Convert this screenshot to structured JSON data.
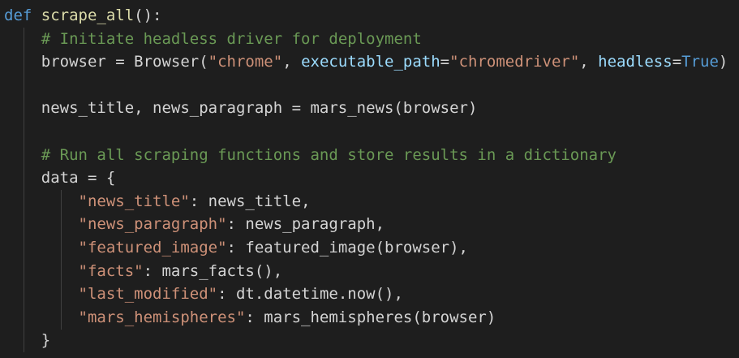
{
  "lines": [
    [
      {
        "t": "def",
        "c": "kw"
      },
      {
        "t": " ",
        "c": "plain"
      },
      {
        "t": "scrape_all",
        "c": "fn"
      },
      {
        "t": "():",
        "c": "plain"
      }
    ],
    [
      {
        "t": "    ",
        "c": "plain"
      },
      {
        "t": "# Initiate headless driver for deployment",
        "c": "cm"
      }
    ],
    [
      {
        "t": "    browser = Browser(",
        "c": "plain"
      },
      {
        "t": "\"chrome\"",
        "c": "str"
      },
      {
        "t": ", ",
        "c": "plain"
      },
      {
        "t": "executable_path",
        "c": "param"
      },
      {
        "t": "=",
        "c": "plain"
      },
      {
        "t": "\"chromedriver\"",
        "c": "str"
      },
      {
        "t": ", ",
        "c": "plain"
      },
      {
        "t": "headless",
        "c": "param"
      },
      {
        "t": "=",
        "c": "plain"
      },
      {
        "t": "True",
        "c": "const"
      },
      {
        "t": ")",
        "c": "plain"
      }
    ],
    [],
    [
      {
        "t": "    news_title, news_paragraph = mars_news(browser)",
        "c": "plain"
      }
    ],
    [],
    [
      {
        "t": "    ",
        "c": "plain"
      },
      {
        "t": "# Run all scraping functions and store results in a dictionary",
        "c": "cm"
      }
    ],
    [
      {
        "t": "    data = {",
        "c": "plain"
      }
    ],
    [
      {
        "t": "        ",
        "c": "plain"
      },
      {
        "t": "\"news_title\"",
        "c": "str"
      },
      {
        "t": ": news_title,",
        "c": "plain"
      }
    ],
    [
      {
        "t": "        ",
        "c": "plain"
      },
      {
        "t": "\"news_paragraph\"",
        "c": "str"
      },
      {
        "t": ": news_paragraph,",
        "c": "plain"
      }
    ],
    [
      {
        "t": "        ",
        "c": "plain"
      },
      {
        "t": "\"featured_image\"",
        "c": "str"
      },
      {
        "t": ": featured_image(browser),",
        "c": "plain"
      }
    ],
    [
      {
        "t": "        ",
        "c": "plain"
      },
      {
        "t": "\"facts\"",
        "c": "str"
      },
      {
        "t": ": mars_facts(),",
        "c": "plain"
      }
    ],
    [
      {
        "t": "        ",
        "c": "plain"
      },
      {
        "t": "\"last_modified\"",
        "c": "str"
      },
      {
        "t": ": dt.datetime.now(),",
        "c": "plain"
      }
    ],
    [
      {
        "t": "        ",
        "c": "plain"
      },
      {
        "t": "\"mars_hemispheres\"",
        "c": "str"
      },
      {
        "t": ": mars_hemispheres(browser)",
        "c": "plain"
      }
    ],
    [
      {
        "t": "    }",
        "c": "plain"
      }
    ]
  ]
}
